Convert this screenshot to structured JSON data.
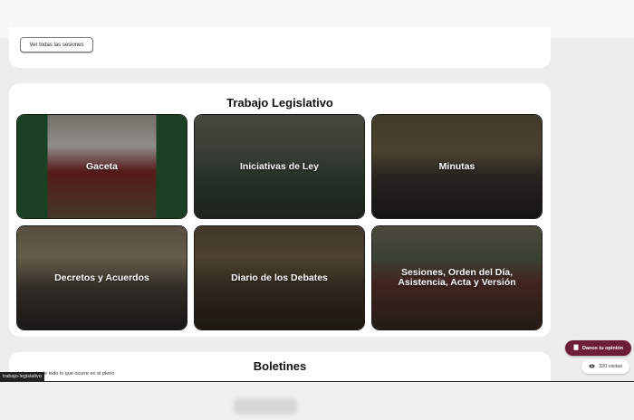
{
  "sessions": {
    "button_label": "Ver todas las sesiones"
  },
  "trabajo": {
    "title": "Trabajo Legislativo",
    "tiles": [
      {
        "label": "Gaceta"
      },
      {
        "label": "Iniciativas de Ley"
      },
      {
        "label": "Minutas"
      },
      {
        "label": "Decretos y Acuerdos"
      },
      {
        "label": "Diario de los Debates"
      },
      {
        "label": "Sesiones, Orden del Día, Asistencia, Acta y Versión"
      }
    ]
  },
  "boletines": {
    "title": "Boletines",
    "subtitle": "informado de todo lo que ocurre en el pleno"
  },
  "tooltip": {
    "text": "trabajo-legislativo"
  },
  "floating": {
    "opinion_label": "Danos tu opinión",
    "visits_label": "320 visitas"
  },
  "colors": {
    "accent": "#6e1d36",
    "card": "#ffffff",
    "page": "#ededed"
  },
  "icons": {
    "opinion": "clipboard-icon",
    "visits": "eye-icon"
  }
}
